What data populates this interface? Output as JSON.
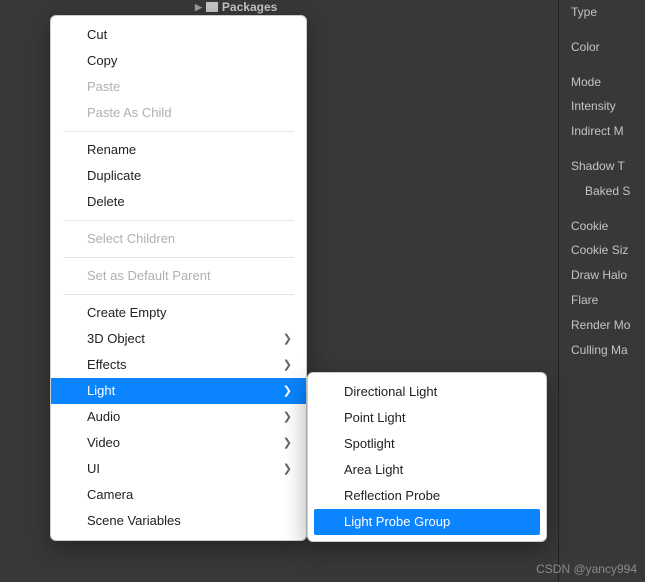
{
  "tree": {
    "item": "Packages"
  },
  "inspector": {
    "rows": [
      {
        "label": "Type",
        "gap": true
      },
      {
        "label": "Color",
        "gap": true
      },
      {
        "label": "Mode"
      },
      {
        "label": "Intensity"
      },
      {
        "label": "Indirect M",
        "gap": true
      },
      {
        "label": "Shadow T"
      },
      {
        "label": "Baked S",
        "indent": true,
        "gap": true
      },
      {
        "label": "Cookie"
      },
      {
        "label": "Cookie Siz"
      },
      {
        "label": "Draw Halo"
      },
      {
        "label": "Flare"
      },
      {
        "label": "Render Mo"
      },
      {
        "label": "Culling Ma"
      }
    ]
  },
  "menu": {
    "groups": [
      [
        {
          "label": "Cut"
        },
        {
          "label": "Copy"
        },
        {
          "label": "Paste",
          "disabled": true
        },
        {
          "label": "Paste As Child",
          "disabled": true
        }
      ],
      [
        {
          "label": "Rename"
        },
        {
          "label": "Duplicate"
        },
        {
          "label": "Delete"
        }
      ],
      [
        {
          "label": "Select Children",
          "disabled": true
        }
      ],
      [
        {
          "label": "Set as Default Parent",
          "disabled": true
        }
      ],
      [
        {
          "label": "Create Empty"
        },
        {
          "label": "3D Object",
          "submenu": true
        },
        {
          "label": "Effects",
          "submenu": true
        },
        {
          "label": "Light",
          "submenu": true,
          "highlight": true
        },
        {
          "label": "Audio",
          "submenu": true
        },
        {
          "label": "Video",
          "submenu": true
        },
        {
          "label": "UI",
          "submenu": true
        },
        {
          "label": "Camera"
        },
        {
          "label": "Scene Variables"
        }
      ]
    ]
  },
  "submenu": {
    "items": [
      {
        "label": "Directional Light"
      },
      {
        "label": "Point Light"
      },
      {
        "label": "Spotlight"
      },
      {
        "label": "Area Light"
      },
      {
        "label": "Reflection Probe"
      },
      {
        "label": "Light Probe Group",
        "highlight": true
      }
    ]
  },
  "watermark": "CSDN @yancy994"
}
